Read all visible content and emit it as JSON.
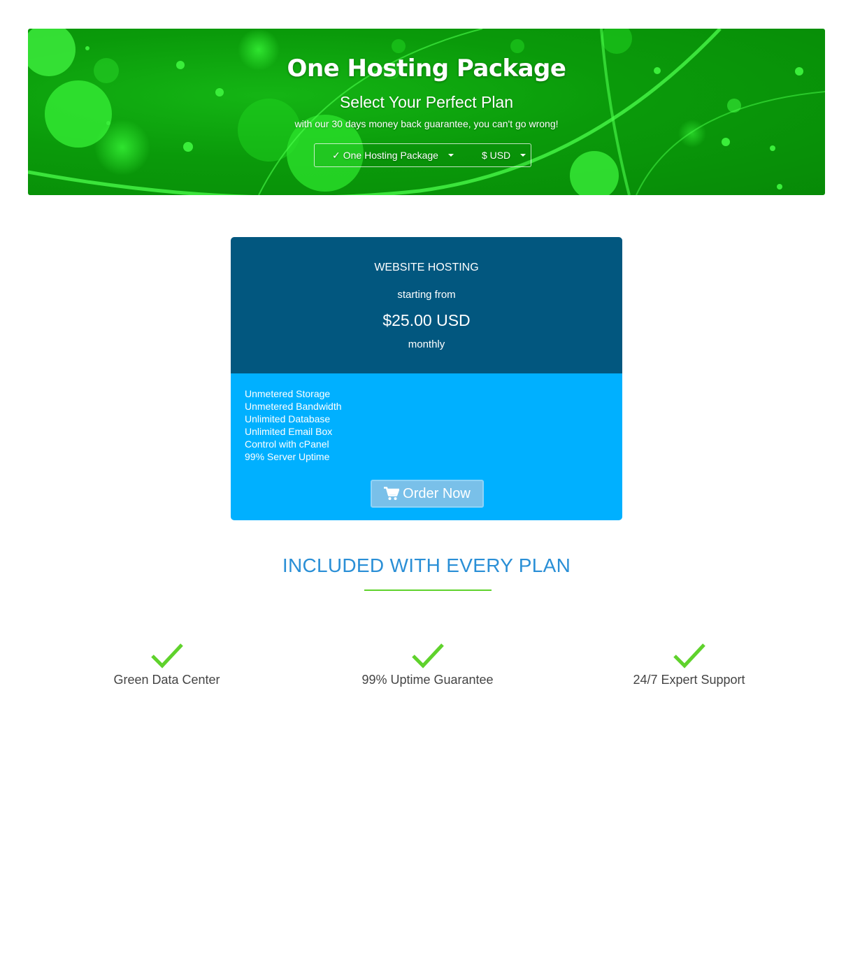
{
  "hero": {
    "title": "One Hosting Package",
    "subtitle": "Select Your Perfect Plan",
    "tagline": "with our 30 days money back guarantee, you can't go wrong!",
    "package_selector": {
      "check": "✓",
      "label": "One Hosting Package",
      "icon": "chevron-down-icon"
    },
    "currency_selector": {
      "label": "$ USD",
      "icon": "chevron-down-icon"
    }
  },
  "plan": {
    "name": "WEBSITE HOSTING",
    "starting_from": "starting from",
    "price": "$25.00 USD",
    "cycle": "monthly",
    "features": [
      "Unmetered Storage",
      "Unmetered Bandwidth",
      "Unlimited Database",
      "Unlimited Email Box",
      "Control with cPanel",
      "99% Server Uptime"
    ],
    "order_button": {
      "label": "Order Now",
      "icon": "cart-icon"
    }
  },
  "included": {
    "title": "INCLUDED WITH EVERY PLAN",
    "items": [
      {
        "label": "Green Data Center",
        "icon": "check-icon"
      },
      {
        "label": "99% Uptime Guarantee",
        "icon": "check-icon"
      },
      {
        "label": "24/7 Expert Support",
        "icon": "check-icon"
      }
    ]
  },
  "colors": {
    "hero_green": "#0a9a0a",
    "card_header": "#02577f",
    "card_body": "#00b0ff",
    "order_button": "#79c0e9",
    "included_title": "#2a8fd6",
    "accent_green": "#5fd22c"
  }
}
